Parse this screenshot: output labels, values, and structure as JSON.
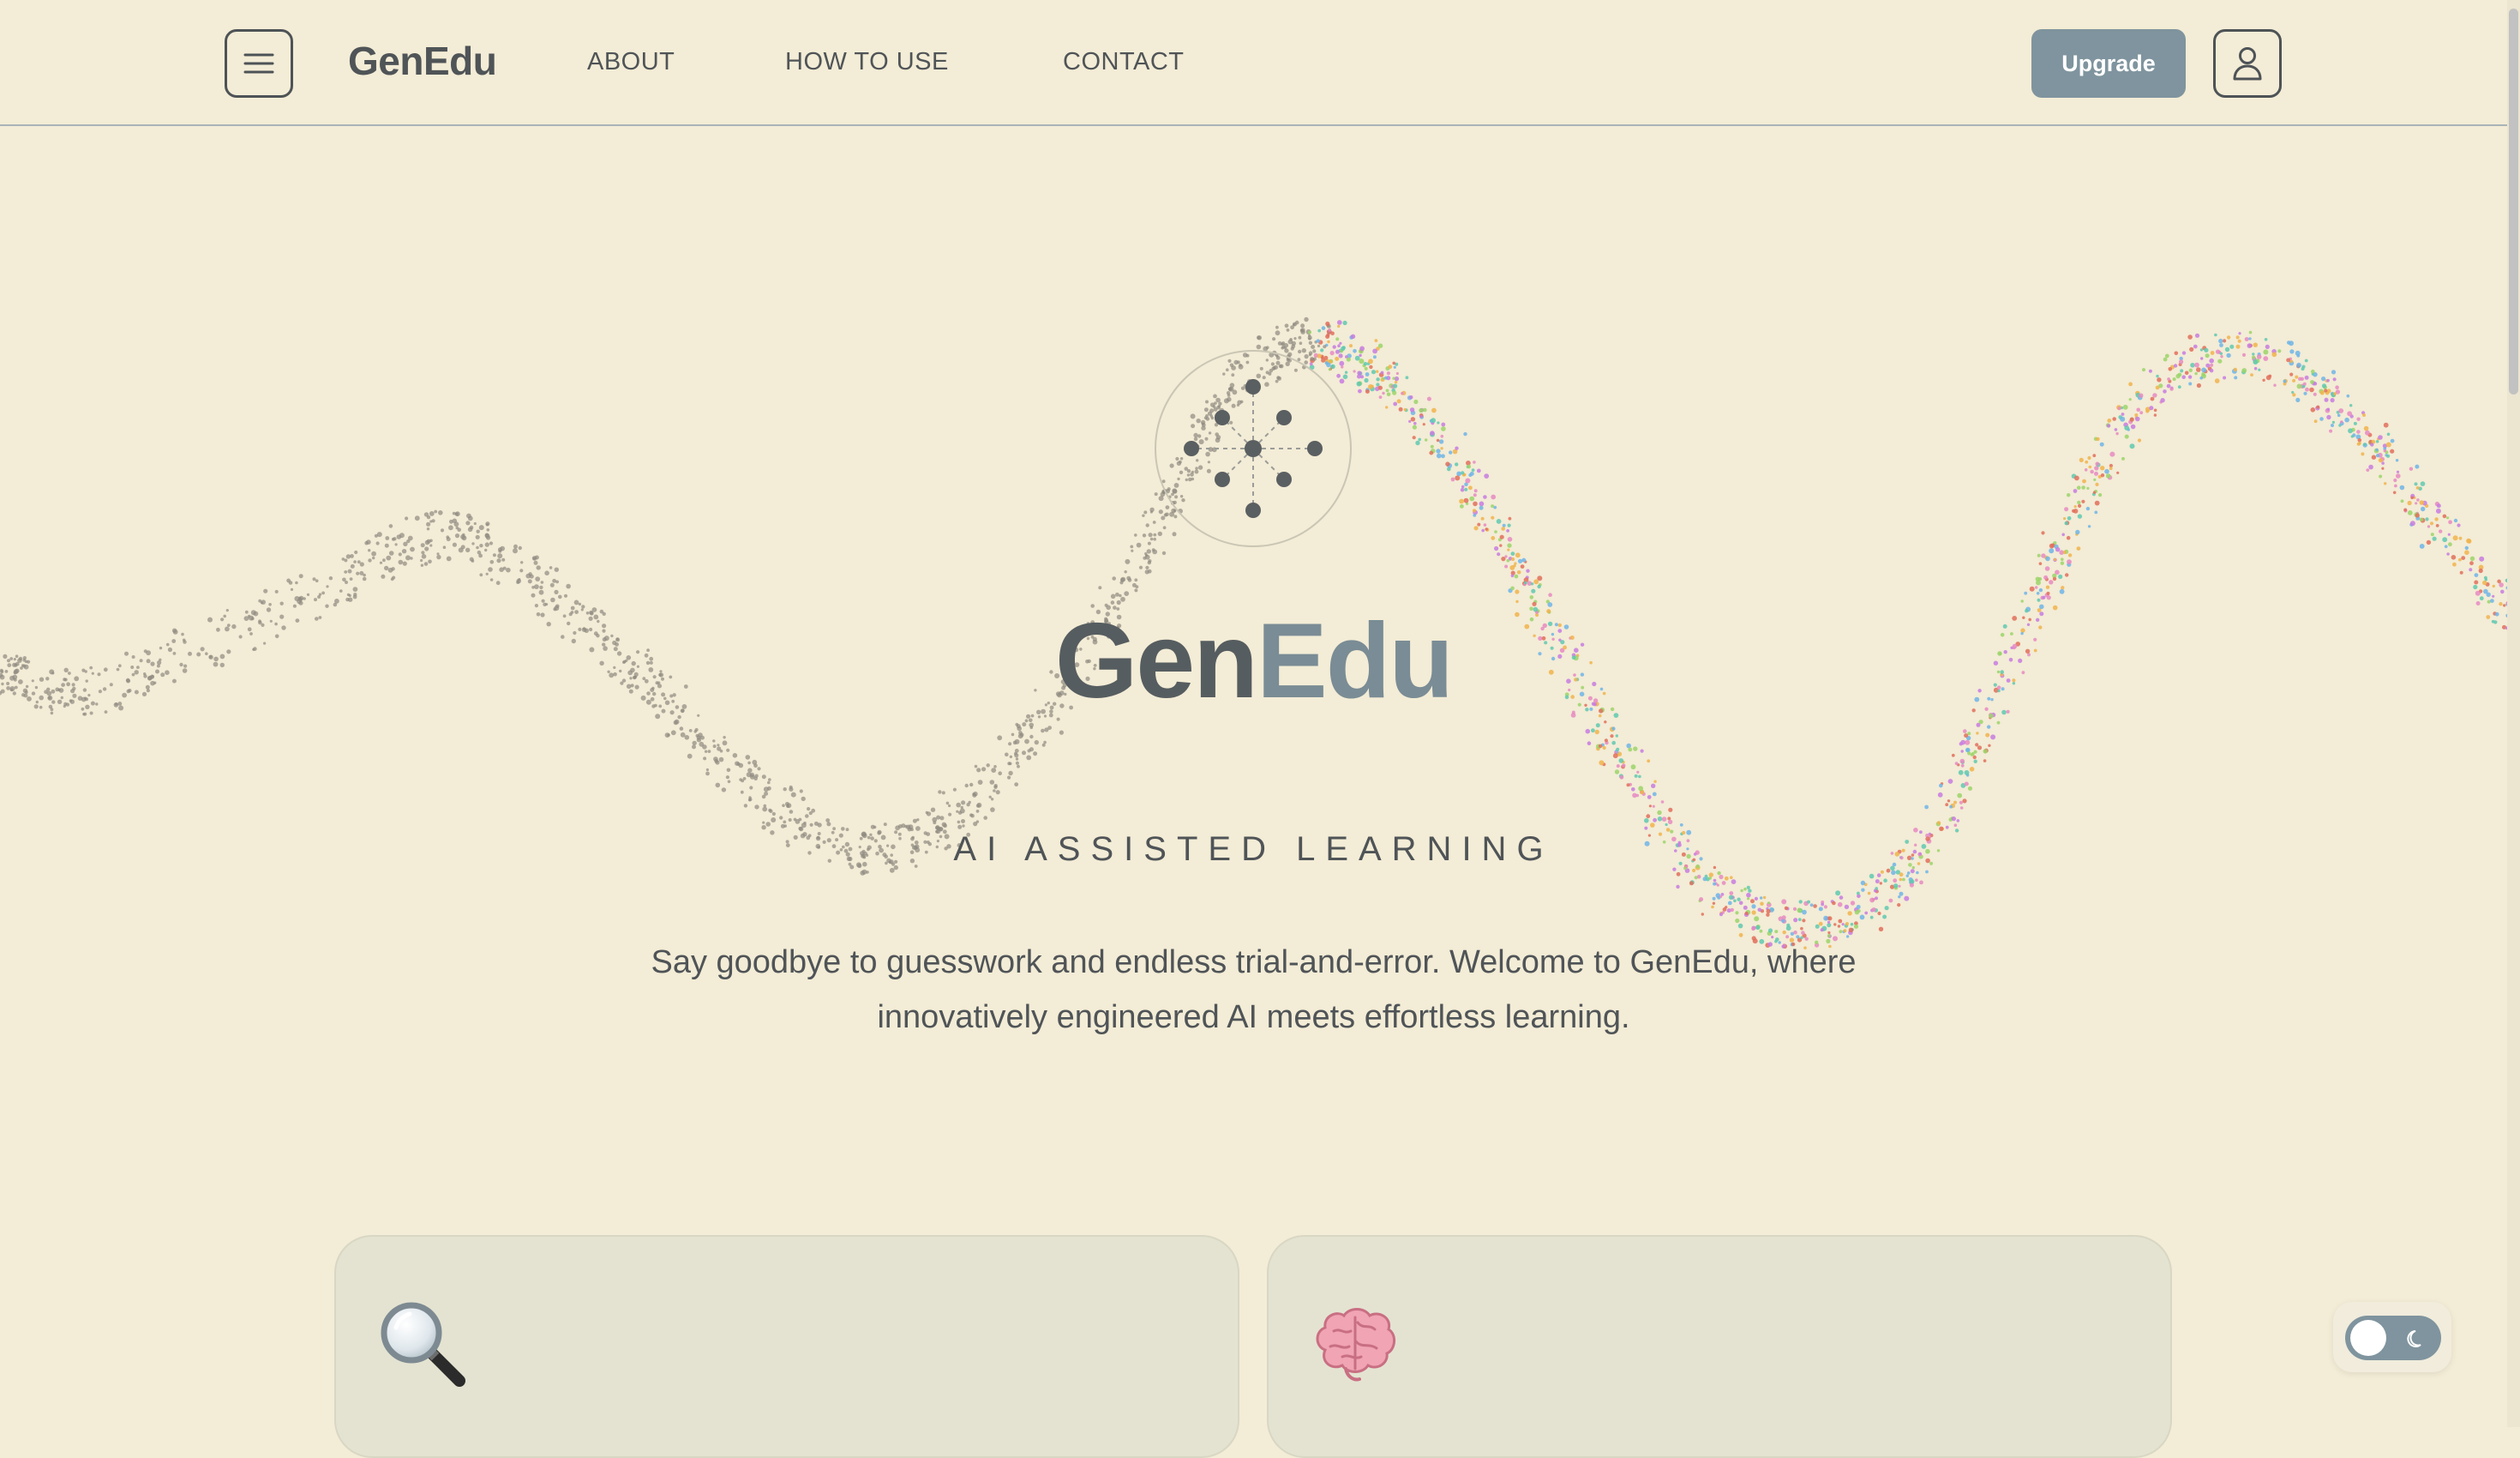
{
  "header": {
    "brand": "GenEdu",
    "nav": [
      {
        "label": "ABOUT"
      },
      {
        "label": "HOW TO USE"
      },
      {
        "label": "CONTACT"
      }
    ],
    "upgrade_label": "Upgrade",
    "menu_icon": "hamburger-menu-icon",
    "user_icon": "user-icon"
  },
  "hero": {
    "logo_icon": "network-nodes-icon",
    "title_part1": "Gen",
    "title_part2": "Edu",
    "subtitle": "AI ASSISTED LEARNING",
    "description": "Say goodbye to guesswork and endless trial-and-error. Welcome to GenEdu, where innovatively engineered AI meets effortless learning."
  },
  "cards": [
    {
      "icon": "magnifying-glass-icon"
    },
    {
      "icon": "brain-icon"
    }
  ],
  "theme_toggle": {
    "state": "light",
    "icon": "moon-icon"
  },
  "colors": {
    "background": "#f3ecd6",
    "accent": "#7f949e",
    "text": "#4f5457",
    "card": "#e4e3d1"
  }
}
